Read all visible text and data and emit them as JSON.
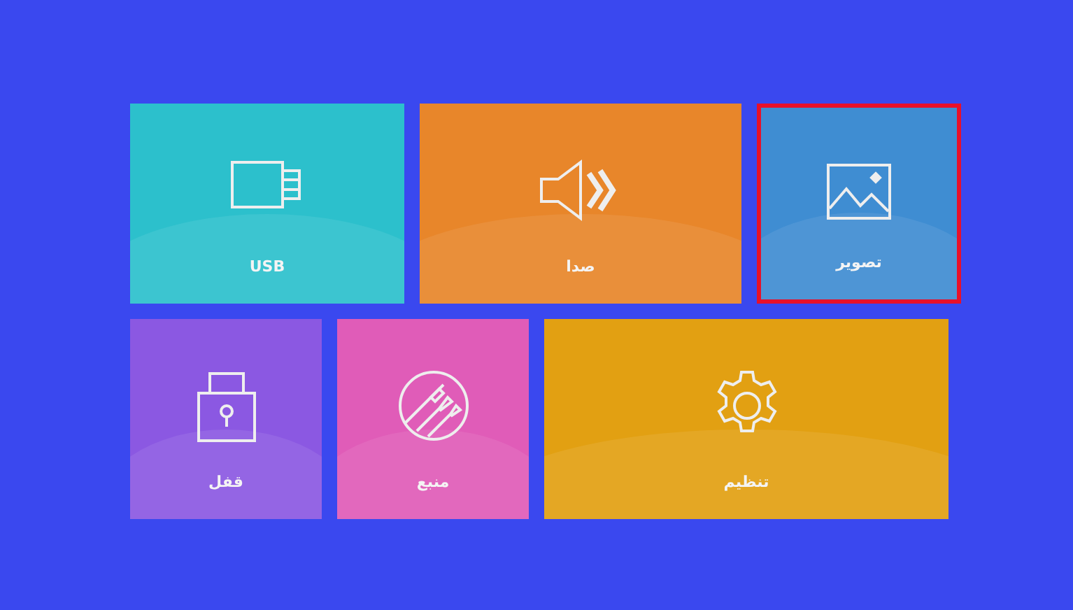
{
  "rows": [
    {
      "tiles": [
        {
          "kind": "picture",
          "label": "تصویر",
          "color": "#3f8dd2",
          "selected": true
        },
        {
          "kind": "sound",
          "label": "صدا",
          "color": "#e8862a",
          "selected": false
        },
        {
          "kind": "usb",
          "label": "USB",
          "color": "#2cc0cc",
          "selected": false
        }
      ]
    },
    {
      "tiles": [
        {
          "kind": "settings",
          "label": "تنظیم",
          "color": "#e2a012",
          "selected": false
        },
        {
          "kind": "source",
          "label": "منبع",
          "color": "#e05cb8",
          "selected": false
        },
        {
          "kind": "lock",
          "label": "قفل",
          "color": "#8b58e2",
          "selected": false
        }
      ]
    }
  ]
}
